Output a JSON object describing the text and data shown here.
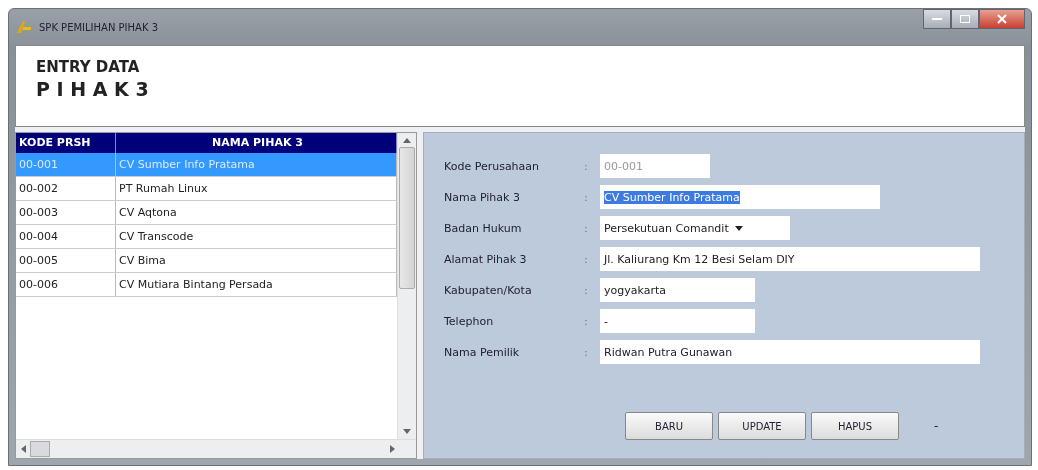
{
  "window": {
    "title": "SPK PEMILIHAN PIHAK 3"
  },
  "header": {
    "line_1": "ENTRY DATA",
    "line_2": "P I H A K 3"
  },
  "table": {
    "columns": [
      "KODE PRSH",
      "NAMA PIHAK 3"
    ],
    "rows": [
      {
        "cells": [
          "00-001",
          "CV Sumber Info Pratama"
        ],
        "selected": true
      },
      {
        "cells": [
          "00-002",
          "PT Rumah Linux"
        ],
        "selected": false
      },
      {
        "cells": [
          "00-003",
          "CV Aqtona"
        ],
        "selected": false
      },
      {
        "cells": [
          "00-004",
          "CV Transcode"
        ],
        "selected": false
      },
      {
        "cells": [
          "00-005",
          "CV Bima"
        ],
        "selected": false
      },
      {
        "cells": [
          "00-006",
          "CV Mutiara Bintang Persada"
        ],
        "selected": false
      }
    ]
  },
  "form": {
    "fields": [
      {
        "kind": "text",
        "label": "Kode Perusahaan",
        "colon": ":",
        "value": "00-001",
        "disabled": true,
        "highlighted": false
      },
      {
        "kind": "text",
        "label": "Nama Pihak 3",
        "colon": ":",
        "value": "CV Sumber Info Pratama",
        "disabled": false,
        "highlighted": true
      },
      {
        "kind": "combo",
        "label": "Badan Hukum",
        "colon": ":",
        "value": "Persekutuan Comandit",
        "disabled": false,
        "highlighted": false
      },
      {
        "kind": "text",
        "label": "Alamat Pihak 3",
        "colon": ":",
        "value": "Jl. Kaliurang Km 12 Besi Selam DIY",
        "disabled": false,
        "highlighted": false
      },
      {
        "kind": "text",
        "label": "Kabupaten/Kota",
        "colon": ":",
        "value": "yogyakarta",
        "disabled": false,
        "highlighted": false
      },
      {
        "kind": "text",
        "label": "Telephon",
        "colon": ":",
        "value": "-",
        "disabled": false,
        "highlighted": false
      },
      {
        "kind": "text",
        "label": "Nama Pemilik",
        "colon": ":",
        "value": "Ridwan Putra Gunawan",
        "disabled": false,
        "highlighted": false
      }
    ],
    "buttons": [
      "BARU",
      "UPDATE",
      "HAPUS"
    ],
    "trailing_mark": "-"
  }
}
